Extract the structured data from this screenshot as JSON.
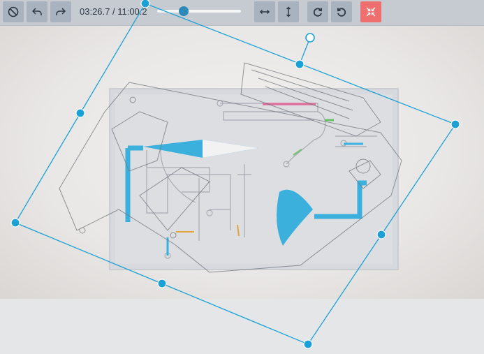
{
  "toolbar": {
    "cancel_icon": "ban-icon",
    "undo_icon": "undo-icon",
    "redo_icon": "redo-icon",
    "time_display": "03:26.7 / 11:00.2",
    "playback_progress": 0.3128,
    "flip_h_icon": "arrows-horizontal-icon",
    "flip_v_icon": "arrows-vertical-icon",
    "rotate_cw_icon": "rotate-clockwise-icon",
    "rotate_ccw_icon": "rotate-counterclockwise-icon",
    "collapse_icon": "collapse-arrows-icon"
  },
  "colors": {
    "toolbar_bg": "#c6cbd2",
    "button_bg": "#a9b3bf",
    "accent": "#2c8ab8",
    "danger": "#ef6e6e",
    "selection": "#1ba1d6"
  }
}
